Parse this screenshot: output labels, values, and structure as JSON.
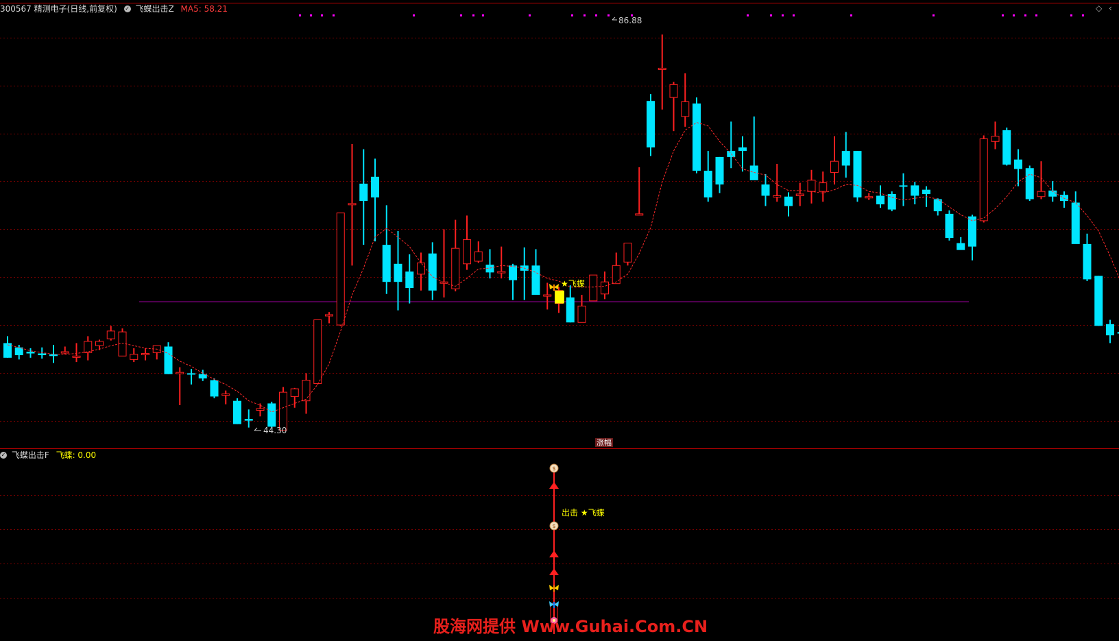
{
  "header": {
    "stock": "300567 精测电子(日线,前复权)",
    "indicator": "飞蝶出击Z",
    "ma_label": "MA5: 58.21"
  },
  "sub_header": {
    "indicator": "飞蝶出击F",
    "value_label": "飞蝶: 0.00"
  },
  "annotations": {
    "high_price": "86.88",
    "low_price": "44.30",
    "signal_label": "★飞蝶",
    "sub_signal_label": "出击 ★飞蝶",
    "date_tag": "涨幅"
  },
  "corner_icons": [
    "diamond-icon",
    "chevron-icon"
  ],
  "corner_glyphs": {
    "diamond": "◇",
    "chevron": "‹"
  },
  "watermark": "股海网提供 Www.Guhai.Com.CN",
  "colors": {
    "up": "#ff2020",
    "down": "#00e5ff",
    "grid": "#7a0000",
    "ma": "#ff2a2a",
    "support": "#b000b0",
    "signal": "#ffff00",
    "dots": "#ff00ff"
  },
  "chart_data": {
    "type": "candlestick",
    "price_range": [
      41.5,
      90.5
    ],
    "support_price": 57.4,
    "candles": [
      {
        "o": 52.6,
        "h": 53.4,
        "l": 50.9,
        "c": 50.9
      },
      {
        "o": 52.1,
        "h": 52.4,
        "l": 50.7,
        "c": 51.2
      },
      {
        "o": 51.6,
        "h": 52.0,
        "l": 50.9,
        "c": 51.4
      },
      {
        "o": 51.4,
        "h": 52.1,
        "l": 50.8,
        "c": 51.2
      },
      {
        "o": 51.3,
        "h": 52.4,
        "l": 50.3,
        "c": 51.1
      },
      {
        "o": 51.6,
        "h": 52.2,
        "l": 51.3,
        "c": 51.6
      },
      {
        "o": 51.0,
        "h": 52.6,
        "l": 50.4,
        "c": 51.1
      },
      {
        "o": 51.5,
        "h": 53.4,
        "l": 50.6,
        "c": 52.8
      },
      {
        "o": 52.3,
        "h": 53.0,
        "l": 51.8,
        "c": 52.8
      },
      {
        "o": 53.1,
        "h": 54.6,
        "l": 52.9,
        "c": 54.0
      },
      {
        "o": 51.1,
        "h": 54.3,
        "l": 51.1,
        "c": 53.9
      },
      {
        "o": 50.7,
        "h": 52.0,
        "l": 50.4,
        "c": 51.3
      },
      {
        "o": 51.4,
        "h": 52.0,
        "l": 50.6,
        "c": 51.4
      },
      {
        "o": 51.5,
        "h": 52.3,
        "l": 50.7,
        "c": 52.3
      },
      {
        "o": 52.2,
        "h": 52.7,
        "l": 49.0,
        "c": 49.0
      },
      {
        "o": 49.2,
        "h": 49.8,
        "l": 45.4,
        "c": 49.2
      },
      {
        "o": 49.1,
        "h": 49.6,
        "l": 47.8,
        "c": 49.0
      },
      {
        "o": 49.0,
        "h": 49.5,
        "l": 48.2,
        "c": 48.5
      },
      {
        "o": 48.3,
        "h": 48.5,
        "l": 46.2,
        "c": 46.4
      },
      {
        "o": 46.6,
        "h": 47.1,
        "l": 45.5,
        "c": 46.7
      },
      {
        "o": 45.9,
        "h": 46.2,
        "l": 43.2,
        "c": 43.2
      },
      {
        "o": 43.8,
        "h": 44.9,
        "l": 42.8,
        "c": 43.6
      },
      {
        "o": 44.8,
        "h": 45.6,
        "l": 44.1,
        "c": 45.0
      },
      {
        "o": 45.6,
        "h": 45.8,
        "l": 42.8,
        "c": 42.9
      },
      {
        "o": 42.5,
        "h": 47.5,
        "l": 42.5,
        "c": 46.9
      },
      {
        "o": 46.4,
        "h": 47.4,
        "l": 45.1,
        "c": 47.3
      },
      {
        "o": 45.9,
        "h": 49.1,
        "l": 44.4,
        "c": 48.3
      },
      {
        "o": 47.9,
        "h": 55.3,
        "l": 47.8,
        "c": 55.3
      },
      {
        "o": 55.9,
        "h": 56.2,
        "l": 54.9,
        "c": 55.9
      },
      {
        "o": 54.7,
        "h": 67.7,
        "l": 54.6,
        "c": 67.7
      },
      {
        "o": 68.8,
        "h": 75.7,
        "l": 61.6,
        "c": 68.8
      },
      {
        "o": 71.1,
        "h": 75.1,
        "l": 64.0,
        "c": 69.1
      },
      {
        "o": 71.9,
        "h": 74.0,
        "l": 64.4,
        "c": 69.5
      },
      {
        "o": 64.0,
        "h": 68.6,
        "l": 58.3,
        "c": 59.7
      },
      {
        "o": 61.8,
        "h": 65.6,
        "l": 56.4,
        "c": 59.7
      },
      {
        "o": 60.9,
        "h": 62.9,
        "l": 57.2,
        "c": 59.0
      },
      {
        "o": 60.6,
        "h": 63.1,
        "l": 58.7,
        "c": 61.9
      },
      {
        "o": 63.0,
        "h": 64.3,
        "l": 57.6,
        "c": 58.7
      },
      {
        "o": 59.7,
        "h": 65.8,
        "l": 57.9,
        "c": 59.7
      },
      {
        "o": 58.9,
        "h": 66.9,
        "l": 58.6,
        "c": 63.6
      },
      {
        "o": 61.8,
        "h": 67.4,
        "l": 61.1,
        "c": 64.6
      },
      {
        "o": 62.1,
        "h": 64.4,
        "l": 61.9,
        "c": 63.2
      },
      {
        "o": 61.7,
        "h": 63.5,
        "l": 60.1,
        "c": 60.8
      },
      {
        "o": 60.9,
        "h": 63.8,
        "l": 60.1,
        "c": 60.9
      },
      {
        "o": 61.6,
        "h": 61.8,
        "l": 57.6,
        "c": 59.9
      },
      {
        "o": 61.6,
        "h": 63.7,
        "l": 57.6,
        "c": 61.0
      },
      {
        "o": 61.6,
        "h": 63.5,
        "l": 58.7,
        "c": 58.2
      },
      {
        "o": 58.2,
        "h": 59.6,
        "l": 56.5,
        "c": 58.2
      },
      {
        "o": 57.2,
        "h": 59.1,
        "l": 56.1,
        "c": 58.7
      },
      {
        "o": 57.9,
        "h": 59.3,
        "l": 55.0,
        "c": 55.0
      },
      {
        "o": 55.0,
        "h": 58.2,
        "l": 55.0,
        "c": 56.9
      },
      {
        "o": 57.5,
        "h": 60.5,
        "l": 57.5,
        "c": 60.5
      },
      {
        "o": 58.3,
        "h": 60.9,
        "l": 57.7,
        "c": 59.7
      },
      {
        "o": 59.5,
        "h": 63.1,
        "l": 59.5,
        "c": 61.6
      },
      {
        "o": 62.0,
        "h": 64.2,
        "l": 61.6,
        "c": 64.2
      },
      {
        "o": 67.5,
        "h": 73.0,
        "l": 67.5,
        "c": 67.6
      },
      {
        "o": 80.7,
        "h": 81.5,
        "l": 74.3,
        "c": 75.3
      },
      {
        "o": 84.5,
        "h": 88.4,
        "l": 79.7,
        "c": 84.5
      },
      {
        "o": 81.1,
        "h": 82.9,
        "l": 77.2,
        "c": 82.6
      },
      {
        "o": 78.9,
        "h": 83.9,
        "l": 77.7,
        "c": 80.6
      },
      {
        "o": 80.4,
        "h": 81.1,
        "l": 72.3,
        "c": 72.6
      },
      {
        "o": 72.6,
        "h": 74.9,
        "l": 69.0,
        "c": 69.5
      },
      {
        "o": 74.2,
        "h": 74.2,
        "l": 70.0,
        "c": 71.0
      },
      {
        "o": 74.9,
        "h": 78.3,
        "l": 72.9,
        "c": 74.2
      },
      {
        "o": 75.3,
        "h": 76.6,
        "l": 72.5,
        "c": 74.9
      },
      {
        "o": 73.2,
        "h": 78.9,
        "l": 71.8,
        "c": 71.5
      },
      {
        "o": 71.0,
        "h": 72.2,
        "l": 68.5,
        "c": 69.7
      },
      {
        "o": 69.7,
        "h": 73.4,
        "l": 69.0,
        "c": 69.7
      },
      {
        "o": 69.6,
        "h": 70.1,
        "l": 67.3,
        "c": 68.5
      },
      {
        "o": 69.7,
        "h": 71.2,
        "l": 68.5,
        "c": 69.9
      },
      {
        "o": 70.2,
        "h": 72.7,
        "l": 68.8,
        "c": 71.5
      },
      {
        "o": 70.2,
        "h": 72.5,
        "l": 69.0,
        "c": 71.2
      },
      {
        "o": 72.4,
        "h": 76.6,
        "l": 71.0,
        "c": 73.7
      },
      {
        "o": 74.9,
        "h": 77.1,
        "l": 71.8,
        "c": 73.2
      },
      {
        "o": 74.9,
        "h": 74.9,
        "l": 69.0,
        "c": 69.5
      },
      {
        "o": 69.6,
        "h": 70.0,
        "l": 69.2,
        "c": 69.6
      },
      {
        "o": 69.7,
        "h": 70.9,
        "l": 68.3,
        "c": 68.7
      },
      {
        "o": 69.9,
        "h": 70.2,
        "l": 67.9,
        "c": 68.1
      },
      {
        "o": 70.9,
        "h": 72.3,
        "l": 68.5,
        "c": 70.8
      },
      {
        "o": 70.9,
        "h": 71.3,
        "l": 68.7,
        "c": 69.7
      },
      {
        "o": 70.4,
        "h": 70.8,
        "l": 68.4,
        "c": 69.9
      },
      {
        "o": 69.3,
        "h": 69.4,
        "l": 67.4,
        "c": 67.9
      },
      {
        "o": 67.6,
        "h": 68.0,
        "l": 64.5,
        "c": 64.8
      },
      {
        "o": 64.2,
        "h": 64.9,
        "l": 63.5,
        "c": 63.4
      },
      {
        "o": 67.3,
        "h": 67.5,
        "l": 62.2,
        "c": 63.8
      },
      {
        "o": 66.8,
        "h": 76.7,
        "l": 66.6,
        "c": 76.3
      },
      {
        "o": 76.0,
        "h": 78.3,
        "l": 75.1,
        "c": 76.6
      },
      {
        "o": 77.3,
        "h": 77.6,
        "l": 73.2,
        "c": 73.3
      },
      {
        "o": 73.9,
        "h": 75.1,
        "l": 70.8,
        "c": 72.8
      },
      {
        "o": 72.9,
        "h": 73.2,
        "l": 69.1,
        "c": 69.3
      },
      {
        "o": 69.6,
        "h": 73.7,
        "l": 69.3,
        "c": 70.2
      },
      {
        "o": 70.3,
        "h": 71.4,
        "l": 69.0,
        "c": 69.6
      },
      {
        "o": 69.8,
        "h": 70.2,
        "l": 68.3,
        "c": 69.1
      },
      {
        "o": 68.9,
        "h": 70.2,
        "l": 66.3,
        "c": 64.1
      },
      {
        "o": 64.1,
        "h": 65.3,
        "l": 59.8,
        "c": 60.0
      },
      {
        "o": 60.4,
        "h": 60.4,
        "l": 54.6,
        "c": 54.6
      },
      {
        "o": 54.8,
        "h": 55.3,
        "l": 52.6,
        "c": 53.5
      },
      {
        "o": 53.9,
        "h": 54.7,
        "l": 53.1,
        "c": 53.7
      },
      {
        "o": 54.0,
        "h": 55.1,
        "l": 51.6,
        "c": 53.6
      },
      {
        "o": 53.8,
        "h": 55.5,
        "l": 53.4,
        "c": 54.1
      },
      {
        "o": 54.1,
        "h": 55.4,
        "l": 53.1,
        "c": 55.2
      },
      {
        "o": 53.1,
        "h": 57.5,
        "l": 52.7,
        "c": 55.6
      },
      {
        "o": 55.5,
        "h": 58.3,
        "l": 55.0,
        "c": 58.3
      }
    ],
    "ma5": [
      52.4,
      52.1,
      51.7,
      51.5,
      51.3,
      51.3,
      51.4,
      51.6,
      51.9,
      52.3,
      52.6,
      52.3,
      52.0,
      51.9,
      51.4,
      50.5,
      49.9,
      49.1,
      48.4,
      47.8,
      47.0,
      45.9,
      45.4,
      44.6,
      45.1,
      45.6,
      46.1,
      47.8,
      50.2,
      54.0,
      58.2,
      61.3,
      64.9,
      65.9,
      64.9,
      63.8,
      61.9,
      60.3,
      59.6,
      59.2,
      60.1,
      61.2,
      61.3,
      61.6,
      61.5,
      61.3,
      60.8,
      60.1,
      59.8,
      59.1,
      59.1,
      59.1,
      59.2,
      59.7,
      60.6,
      63.0,
      66.0,
      71.3,
      74.9,
      77.3,
      78.2,
      77.8,
      76.0,
      74.6,
      72.8,
      72.4,
      72.1,
      71.0,
      70.3,
      70.3,
      70.2,
      70.0,
      70.4,
      71.0,
      70.9,
      70.2,
      70.0,
      69.5,
      69.2,
      69.4,
      69.6,
      69.3,
      68.4,
      67.5,
      66.8,
      67.1,
      68.2,
      69.6,
      71.3,
      72.2,
      71.8,
      70.2,
      69.4,
      68.9,
      67.4,
      65.6,
      62.7,
      59.5,
      57.9,
      55.6,
      54.3,
      54.0,
      54.4,
      55.4
    ]
  }
}
